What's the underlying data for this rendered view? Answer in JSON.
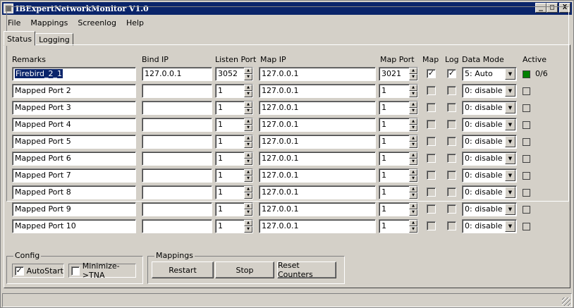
{
  "window": {
    "title": "IBExpertNetworkMonitor V1.0",
    "min_label": "_",
    "max_label": "□",
    "close_label": "X"
  },
  "menu": [
    "File",
    "Mappings",
    "Screenlog",
    "Help"
  ],
  "tabs": [
    "Status",
    "Logging"
  ],
  "headers": {
    "remarks": "Remarks",
    "bind_ip": "Bind IP",
    "listen_port": "Listen Port",
    "map_ip": "Map IP",
    "map_port": "Map Port",
    "map": "Map",
    "log": "Log",
    "data_mode": "Data Mode",
    "active": "Active"
  },
  "rows": [
    {
      "remarks": "Firebird_2_1",
      "bind_ip": "127.0.0.1",
      "listen_port": "3052",
      "map_ip": "127.0.0.1",
      "map_port": "3021",
      "map": "✓",
      "log": "✓",
      "data_mode": "5: Auto",
      "active": true,
      "active_text": "0/6"
    },
    {
      "remarks": "Mapped Port 2",
      "bind_ip": "",
      "listen_port": "1",
      "map_ip": "127.0.0.1",
      "map_port": "1",
      "map": "",
      "log": "",
      "data_mode": "0: disable",
      "active": false,
      "active_text": ""
    },
    {
      "remarks": "Mapped Port 3",
      "bind_ip": "",
      "listen_port": "1",
      "map_ip": "127.0.0.1",
      "map_port": "1",
      "map": "",
      "log": "",
      "data_mode": "0: disable",
      "active": false,
      "active_text": ""
    },
    {
      "remarks": "Mapped Port 4",
      "bind_ip": "",
      "listen_port": "1",
      "map_ip": "127.0.0.1",
      "map_port": "1",
      "map": "",
      "log": "",
      "data_mode": "0: disable",
      "active": false,
      "active_text": ""
    },
    {
      "remarks": "Mapped Port 5",
      "bind_ip": "",
      "listen_port": "1",
      "map_ip": "127.0.0.1",
      "map_port": "1",
      "map": "",
      "log": "",
      "data_mode": "0: disable",
      "active": false,
      "active_text": ""
    },
    {
      "remarks": "Mapped Port 6",
      "bind_ip": "",
      "listen_port": "1",
      "map_ip": "127.0.0.1",
      "map_port": "1",
      "map": "",
      "log": "",
      "data_mode": "0: disable",
      "active": false,
      "active_text": ""
    },
    {
      "remarks": "Mapped Port 7",
      "bind_ip": "",
      "listen_port": "1",
      "map_ip": "127.0.0.1",
      "map_port": "1",
      "map": "",
      "log": "",
      "data_mode": "0: disable",
      "active": false,
      "active_text": ""
    },
    {
      "remarks": "Mapped Port 8",
      "bind_ip": "",
      "listen_port": "1",
      "map_ip": "127.0.0.1",
      "map_port": "1",
      "map": "",
      "log": "",
      "data_mode": "0: disable",
      "active": false,
      "active_text": ""
    },
    {
      "remarks": "Mapped Port 9",
      "bind_ip": "",
      "listen_port": "1",
      "map_ip": "127.0.0.1",
      "map_port": "1",
      "map": "",
      "log": "",
      "data_mode": "0: disable",
      "active": false,
      "active_text": ""
    },
    {
      "remarks": "Mapped Port 10",
      "bind_ip": "",
      "listen_port": "1",
      "map_ip": "127.0.0.1",
      "map_port": "1",
      "map": "",
      "log": "",
      "data_mode": "0: disable",
      "active": false,
      "active_text": ""
    }
  ],
  "config": {
    "title": "Config",
    "autostart_label": "AutoStart",
    "autostart_checked": "✓",
    "minimize_label": "Minimize->TNA",
    "minimize_checked": ""
  },
  "mappings": {
    "title": "Mappings",
    "restart_label": "Restart",
    "stop_label": "Stop",
    "reset_label": "Reset Counters"
  },
  "colors": {
    "titlebar": "#0a246a",
    "face": "#d4d0c8",
    "active_on": "#008000"
  },
  "icons": {
    "app": "app-icon",
    "spin_up": "▲",
    "spin_down": "▼",
    "combo": "▼"
  }
}
